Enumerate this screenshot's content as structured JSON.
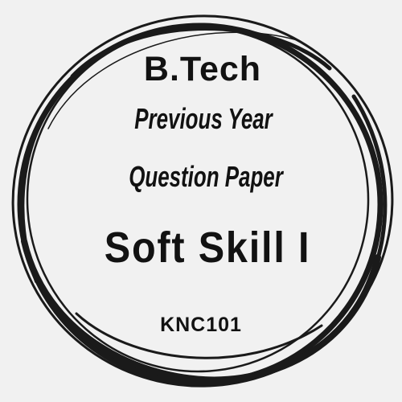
{
  "badge": {
    "degree": "B.Tech",
    "line1": "Previous Year",
    "line2": "Question Paper",
    "subject": "Soft Skill I",
    "code": "KNC101"
  },
  "colors": {
    "background": "#f1f1f1",
    "ink": "#121212"
  }
}
